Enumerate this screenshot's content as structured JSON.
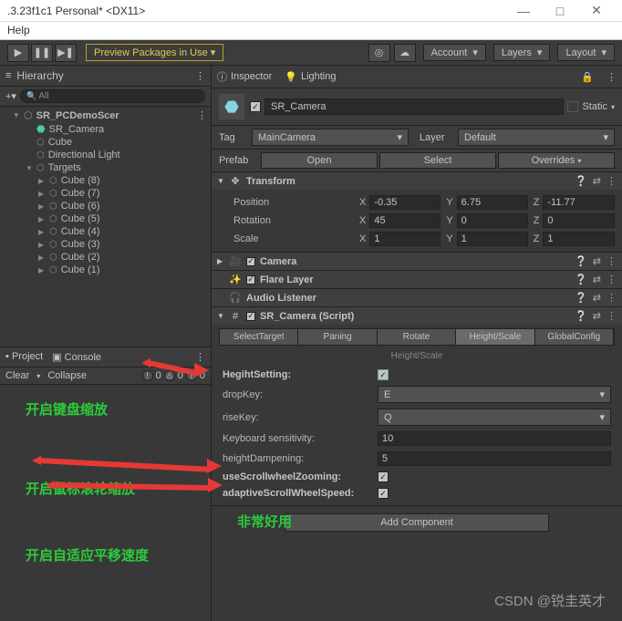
{
  "window": {
    "title": ".3.23f1c1 Personal* <DX11>",
    "min": "—",
    "max": "□",
    "close": "✕"
  },
  "menu": {
    "help": "Help"
  },
  "toolbar": {
    "preview": "Preview Packages in Use ▾",
    "account": "Account",
    "layers": "Layers",
    "layout": "Layout"
  },
  "hierarchy": {
    "title": "Hierarchy",
    "search": "All",
    "scene": "SR_PCDemoScer",
    "items": [
      "SR_Camera",
      "Cube",
      "Directional Light"
    ],
    "targets": "Targets",
    "cubes": [
      "Cube (8)",
      "Cube (7)",
      "Cube (6)",
      "Cube (5)",
      "Cube (4)",
      "Cube (3)",
      "Cube (2)",
      "Cube (1)"
    ]
  },
  "project": {
    "tab1": "Project",
    "tab2": "Console",
    "clear": "Clear",
    "collapse": "Collapse",
    "n0": "0",
    "n1": "0",
    "n2": "0"
  },
  "inspector": {
    "tab1": "Inspector",
    "tab2": "Lighting",
    "name": "SR_Camera",
    "static": "Static",
    "tag_lbl": "Tag",
    "tag": "MainCamera",
    "layer_lbl": "Layer",
    "layer": "Default",
    "prefab_lbl": "Prefab",
    "open": "Open",
    "select": "Select",
    "overrides": "Overrides"
  },
  "transform": {
    "title": "Transform",
    "pos_lbl": "Position",
    "rot_lbl": "Rotation",
    "scl_lbl": "Scale",
    "X": "X",
    "Y": "Y",
    "Z": "Z",
    "px": "-0.35",
    "py": "6.75",
    "pz": "-11.77",
    "rx": "45",
    "ry": "0",
    "rz": "0",
    "sx": "1",
    "sy": "1",
    "sz": "1"
  },
  "comps": {
    "camera": "Camera",
    "flare": "Flare Layer",
    "audio": "Audio Listener",
    "script": "SR_Camera (Script)"
  },
  "script": {
    "tabs": [
      "SelectTarget",
      "Paning",
      "Rotate",
      "Height/Scale",
      "GlobalConfig"
    ],
    "sub": "Height/Scale",
    "heightSetting": "HegihtSetting:",
    "dropKey": "dropKey:",
    "dropVal": "E",
    "riseKey": "riseKey:",
    "riseVal": "Q",
    "keySens": "Keyboard sensitivity:",
    "keySensVal": "10",
    "heightDamp": "heightDampening:",
    "heightDampVal": "5",
    "scrollZoom": "useScrollwheelZooming:",
    "adaptive": "adaptiveScrollWheelSpeed:"
  },
  "addComp": "Add Component",
  "annos": {
    "a1": "开启键盘缩放",
    "a2": "开启鼠标滚轮缩放",
    "a3": "开启自适应平移速度",
    "a4": "非常好用"
  },
  "watermark": "CSDN @锐圭英才"
}
